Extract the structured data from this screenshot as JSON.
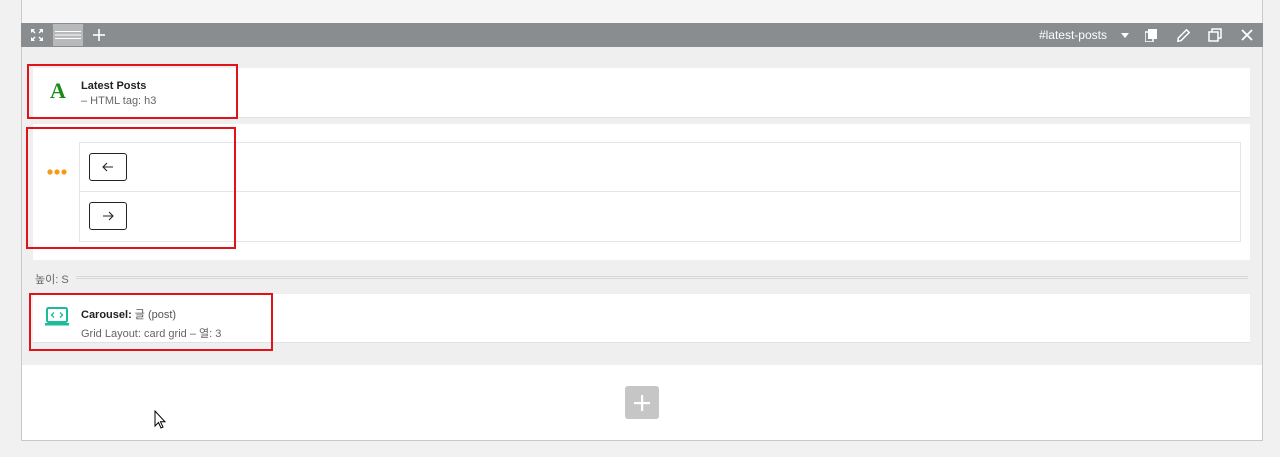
{
  "toolbar": {
    "row_id": "#latest-posts",
    "left_icons": [
      "move-icon",
      "drag-handle-icon",
      "plus-icon"
    ],
    "right_icons": [
      "chevron-down-icon",
      "copy-icon",
      "pencil-icon",
      "duplicate-icon",
      "close-icon"
    ]
  },
  "modules": {
    "latest_posts": {
      "title": "Latest Posts",
      "subtitle": "– HTML tag: h3",
      "icon": "heading-a-icon",
      "icon_color": "#1a8a1a"
    },
    "arrows": {
      "icon": "dots-icon",
      "icon_color": "#f39c12",
      "prev_icon": "arrow-left-icon",
      "next_icon": "arrow-right-icon"
    },
    "carousel": {
      "title": "Carousel:",
      "title_light": " 글 (post)",
      "subtitle": "Grid Layout: card grid – 열: 3",
      "icon": "carousel-icon",
      "icon_color": "#1abc9c"
    }
  },
  "height_label": "높이: S",
  "add_section_icon": "plus-icon",
  "colors": {
    "highlight": "#e0121a",
    "toolbar": "#8a8d90"
  }
}
